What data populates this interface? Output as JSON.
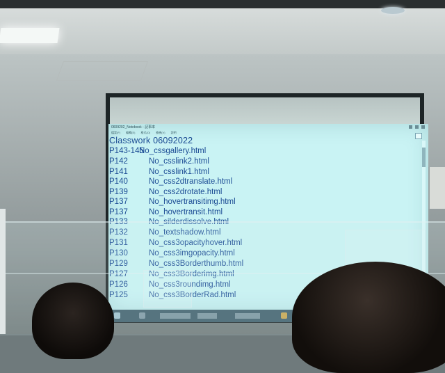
{
  "notepad": {
    "title": "0609202_Notebook - 記事本",
    "menu": [
      "檔案(F)",
      "編輯(E)",
      "格式(O)",
      "檢視(V)",
      "說明"
    ],
    "heading": "Classwork 06092022",
    "rows": [
      {
        "page": "P143-145",
        "file": "No_cssgallery.html"
      },
      {
        "page": "P142",
        "file": "No_csslink2.html"
      },
      {
        "page": "P141",
        "file": "No_csslink1.html"
      },
      {
        "page": "P140",
        "file": "No_css2dtranslate.html"
      },
      {
        "page": "P139",
        "file": "No_css2drotate.html"
      },
      {
        "page": "P137",
        "file": "No_hovertransitimg.html"
      },
      {
        "page": "P137",
        "file": "No_hovertransit.html"
      },
      {
        "page": "P133",
        "file": "No_silderdissolve.html"
      },
      {
        "page": "P132",
        "file": "No_textshadow.html"
      },
      {
        "page": "P131",
        "file": "No_css3opacityhover.html"
      },
      {
        "page": "P130",
        "file": "No_css3imgopacity.html"
      },
      {
        "page": "P129",
        "file": "No_css3Borderthumb.html"
      },
      {
        "page": "P127",
        "file": "No_css3Borderimg.html"
      },
      {
        "page": "P126",
        "file": "No_css3roundimg.html"
      },
      {
        "page": "P125",
        "file": "No_css3BorderRad.html"
      }
    ]
  },
  "colors": {
    "window_bg": "#c9f3f4",
    "text": "#1b4b94",
    "taskbar": "#3f5d6b"
  }
}
